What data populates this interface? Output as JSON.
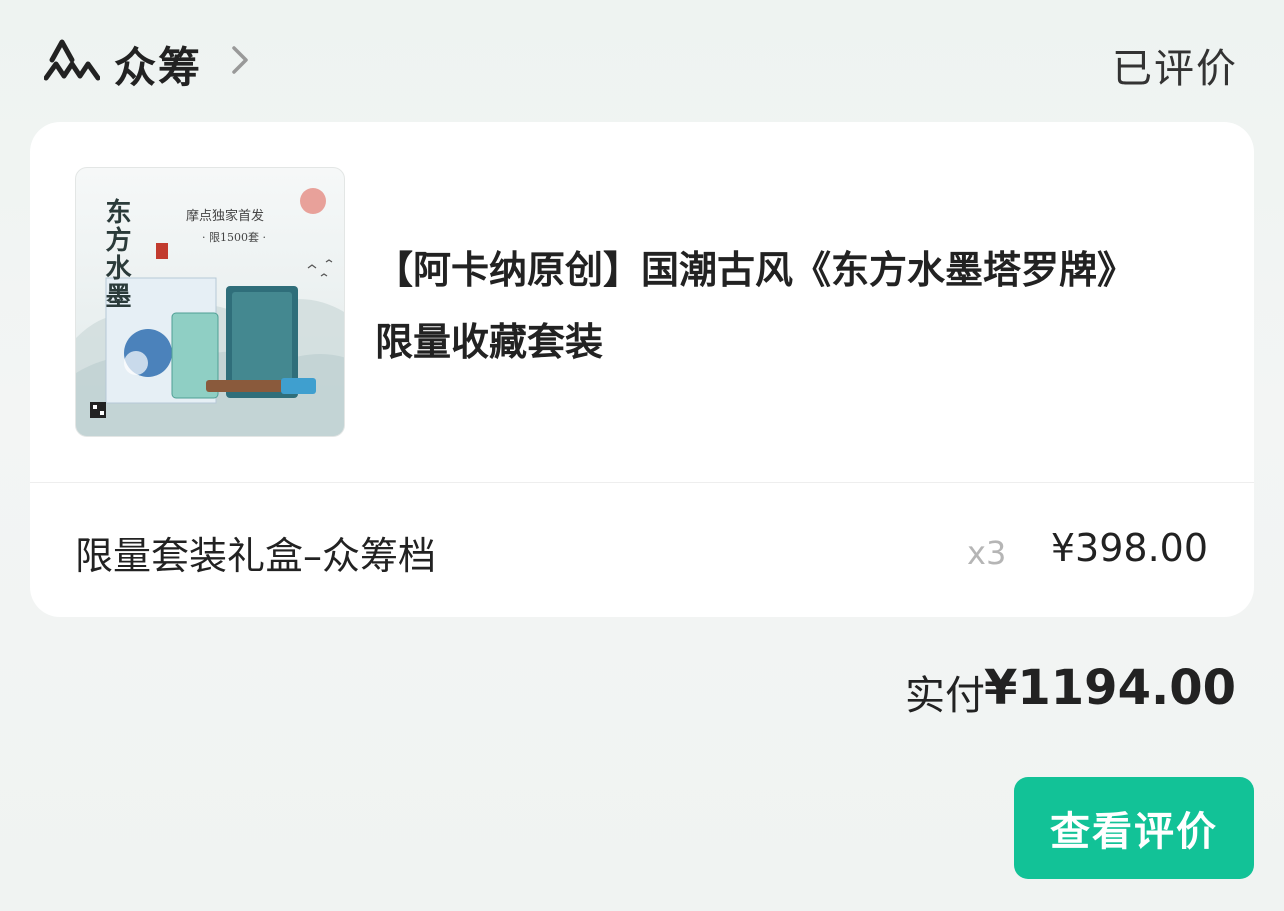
{
  "header": {
    "brand_name": "众筹",
    "brand_icon": "crowdfunding-mountain-icon",
    "chevron_icon": "chevron-right-icon",
    "status": "已评价"
  },
  "product": {
    "title": "【阿卡纳原创】国潮古风《东方水墨塔罗牌》限量收藏套装",
    "image_text": {
      "vertical_title": "东方水墨",
      "tag_line1": "摩点独家首发",
      "tag_line2": "· 限1500套 ·"
    },
    "variant": "限量套装礼盒–众筹档",
    "quantity": "x3",
    "price": "¥398.00"
  },
  "summary": {
    "paid_label": "实付",
    "paid_amount": "¥1194.00"
  },
  "actions": {
    "view_review": "查看评价"
  },
  "colors": {
    "accent": "#12c297",
    "background": "#eef3f1",
    "card": "#ffffff",
    "muted": "#b5b5b5"
  }
}
